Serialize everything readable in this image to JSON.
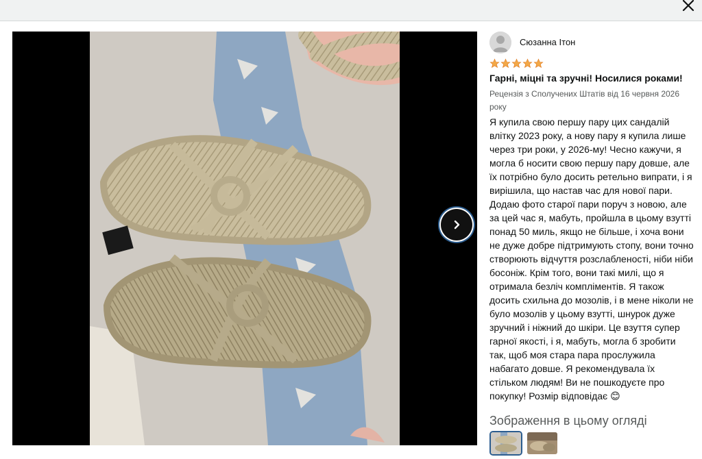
{
  "review": {
    "reviewer_name": "Сюзанна Ітон",
    "rating": 5,
    "title": "Гарні, міцні та зручні! Носилися роками!",
    "meta": "Рецензія з Сполучених Штатів від 16 червня 2026 року",
    "body": "Я купила свою першу пару цих сандалій влітку 2023 року, а нову пару я купила лише через три роки, у 2026-му! Чесно кажучи, я могла б носити свою першу пару довше, але їх потрібно було досить ретельно випрати, і я вирішила, що настав час для нової пари. Додаю фото старої пари поруч з новою, але за цей час я, мабуть, пройшла в цьому взутті понад 50 миль, якщо не більше, і хоча вони не дуже добре підтримують стопу, вони точно створюють відчуття розслабленості, ніби ніби босоніж. Крім того, вони такі милі, що я отримала безліч компліментів. Я також досить схильна до мозолів, і в мене ніколи не було мозолів у цьому взутті, шнурок дуже зручний і ніжний до шкіри. Це взуття супер гарної якості, і я, мабуть, могла б зробити так, щоб моя стара пара прослужила набагато довше. Я рекомендувала їх стільком людям! Ви не пошкодуєте про покупку! Розмір відповідає 😊"
  },
  "images_section": {
    "heading": "Зображення в цьому огляді"
  },
  "icons": {
    "close": "close-icon",
    "next": "chevron-right-icon",
    "avatar": "user-avatar-icon",
    "star": "star-icon"
  },
  "colors": {
    "star": "#f3a847",
    "star_outline": "#de7921",
    "focus_ring": "#2c5d8f"
  }
}
